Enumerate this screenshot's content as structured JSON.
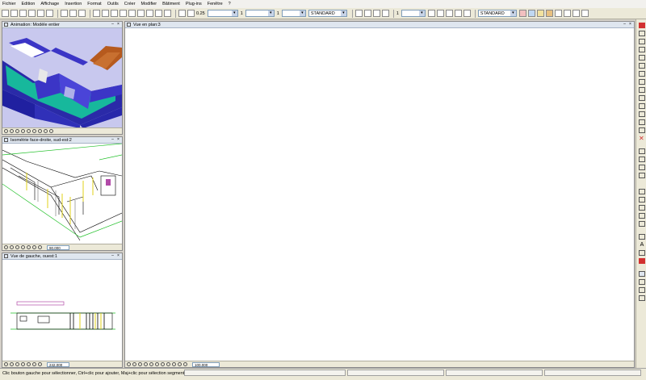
{
  "menu": [
    "Fichier",
    "Edition",
    "Affichage",
    "Insertion",
    "Format",
    "Outils",
    "Créer",
    "Modifier",
    "Bâtiment",
    "Plug-ins",
    "Fenêtre",
    "?"
  ],
  "toolbar": {
    "line_weight": "0.25",
    "line_type_number": "1",
    "layer_number": "1",
    "style_a": "STANDARD",
    "pen_number": "1",
    "style_b": "STANDARD"
  },
  "panels": {
    "animation_title": "Animation: Modèle entier",
    "isometric_title": "Isométrie face-droite, sud-est:2",
    "left_view_title": "Vue de gauche, ouest:1",
    "plan_title": "Vue en plan:3"
  },
  "zoom": {
    "isometric": "90.000",
    "left_view": "242.000",
    "plan": "100.000"
  },
  "status": {
    "message": "Clic bouton gauche pour sélectionner, Ctrl+clic pour ajouter, Maj+clic pour sélection segment"
  },
  "icons": [
    "new-icon",
    "open-icon",
    "save-icon",
    "print-icon",
    "undo-icon",
    "redo-icon",
    "pencil-icon",
    "line-icon",
    "delete-icon",
    "text-icon",
    "zoom-icon",
    "pan-icon"
  ],
  "colors": {
    "wall_blue": "#3b35c6",
    "floor_teal": "#17b89c",
    "roof_brown": "#b65a1e",
    "sky_lilac": "#c8c8ee",
    "iso_green": "#22c02a",
    "iso_yellow": "#e0d218"
  }
}
